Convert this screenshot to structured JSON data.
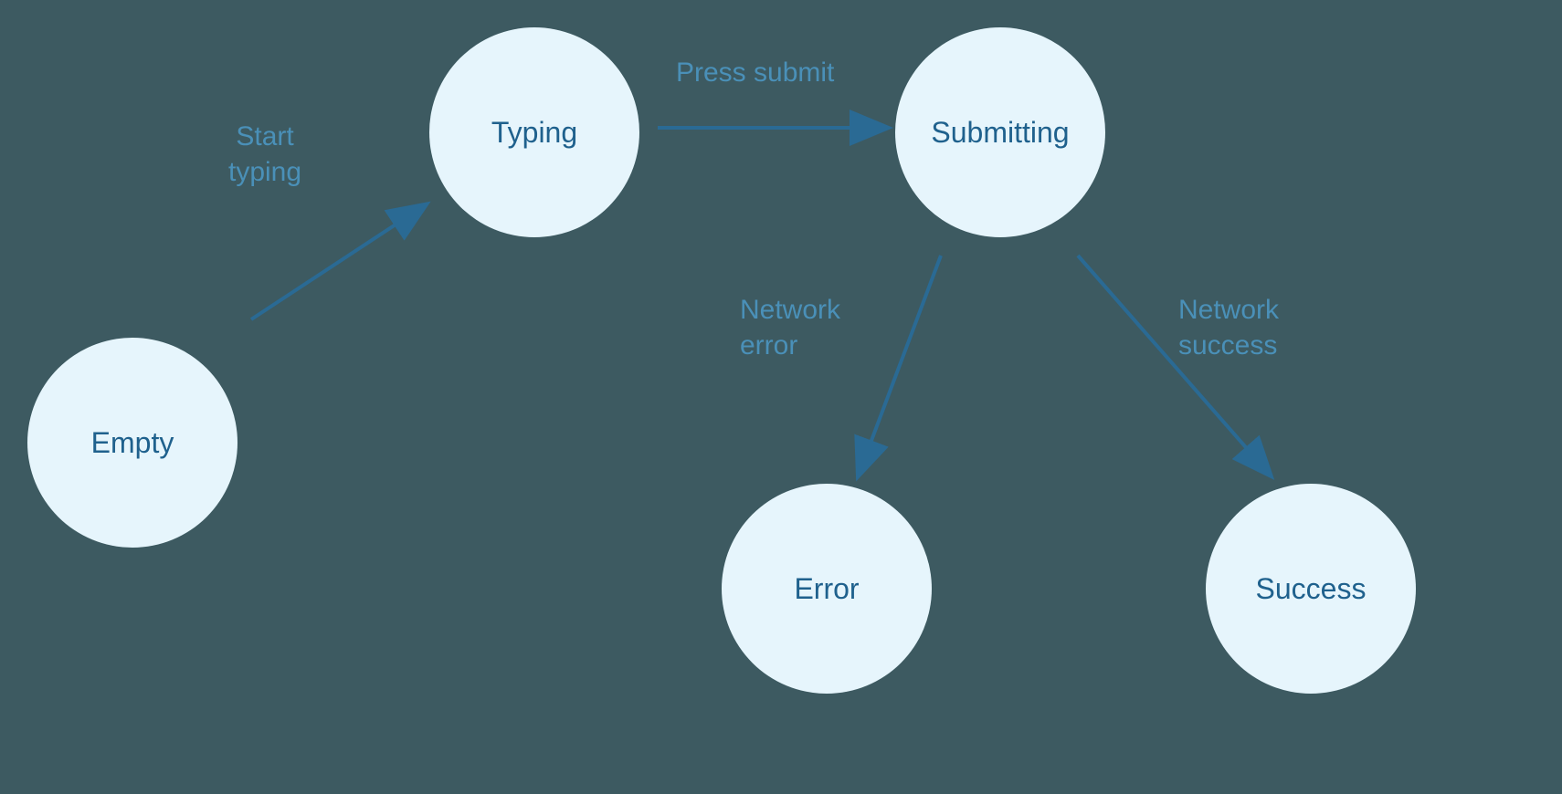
{
  "nodes": {
    "empty": "Empty",
    "typing": "Typing",
    "submitting": "Submitting",
    "error": "Error",
    "success": "Success"
  },
  "edges": {
    "start_typing_l1": "Start",
    "start_typing_l2": "typing",
    "press_submit": "Press submit",
    "network_error_l1": "Network",
    "network_error_l2": "error",
    "network_success_l1": "Network",
    "network_success_l2": "success"
  },
  "colors": {
    "background": "#3d5a61",
    "node_fill": "#e6f5fc",
    "node_text": "#1f618d",
    "edge_label": "#4a90b8",
    "arrow": "#2a6a94"
  }
}
